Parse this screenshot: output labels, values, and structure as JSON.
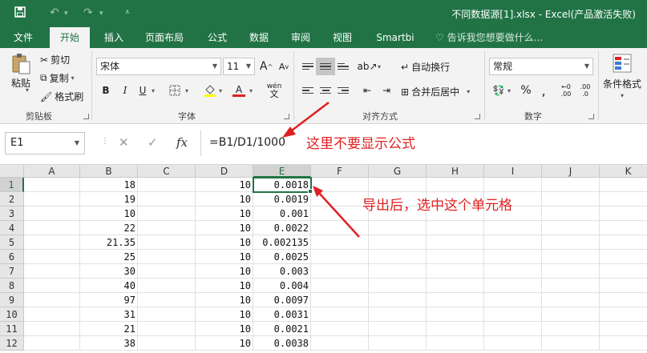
{
  "window": {
    "title": "不同数据源[1].xlsx - Excel(产品激活失败)",
    "qat_save_icon": "save-icon",
    "qat_undo_icon": "undo-icon",
    "qat_redo_icon": "redo-icon",
    "qat_customize_icon": "customize-qat-icon"
  },
  "tabs": [
    "文件",
    "开始",
    "插入",
    "页面布局",
    "公式",
    "数据",
    "审阅",
    "视图",
    "Smartbi"
  ],
  "active_tab": "开始",
  "tellme": "告诉我您想要做什么...",
  "ribbon": {
    "clipboard": {
      "paste": "粘贴",
      "cut": "剪切",
      "copy": "复制",
      "format_painter": "格式刷",
      "label": "剪贴板"
    },
    "font": {
      "name": "宋体",
      "size": "11",
      "bold": "B",
      "italic": "I",
      "underline": "U",
      "grow": "A",
      "shrink": "A",
      "phonetic": "wén",
      "font_color_letter": "A",
      "label": "字体"
    },
    "alignment": {
      "wrap": "自动换行",
      "merge": "合并后居中",
      "label": "对齐方式"
    },
    "number": {
      "format": "常规",
      "percent": "%",
      "comma": ",",
      "inc_decimal": ".00",
      "dec_decimal": ".0",
      "label": "数字"
    },
    "styles": {
      "conditional": "条件格式"
    }
  },
  "formula_bar": {
    "name_box": "E1",
    "cancel": "✕",
    "enter": "✓",
    "fx": "fx",
    "formula": "=B1/D1/1000"
  },
  "grid": {
    "columns": [
      "A",
      "B",
      "C",
      "D",
      "E",
      "F",
      "G",
      "H",
      "I",
      "J",
      "K"
    ],
    "selected_column": "E",
    "selected_row": 1,
    "rows": [
      {
        "n": 1,
        "B": "18",
        "D": "10",
        "E": "0.0018"
      },
      {
        "n": 2,
        "B": "19",
        "D": "10",
        "E": "0.0019"
      },
      {
        "n": 3,
        "B": "10",
        "D": "10",
        "E": "0.001"
      },
      {
        "n": 4,
        "B": "22",
        "D": "10",
        "E": "0.0022"
      },
      {
        "n": 5,
        "B": "21.35",
        "D": "10",
        "E": "0.002135"
      },
      {
        "n": 6,
        "B": "25",
        "D": "10",
        "E": "0.0025"
      },
      {
        "n": 7,
        "B": "30",
        "D": "10",
        "E": "0.003"
      },
      {
        "n": 8,
        "B": "40",
        "D": "10",
        "E": "0.004"
      },
      {
        "n": 9,
        "B": "97",
        "D": "10",
        "E": "0.0097"
      },
      {
        "n": 10,
        "B": "31",
        "D": "10",
        "E": "0.0031"
      },
      {
        "n": 11,
        "B": "21",
        "D": "10",
        "E": "0.0021"
      },
      {
        "n": 12,
        "B": "38",
        "D": "10",
        "E": "0.0038"
      }
    ]
  },
  "annotations": {
    "formula_note": "这里不要显示公式",
    "cell_note": "导出后，选中这个单元格",
    "color": "#e02020"
  },
  "colors": {
    "brand": "#217346",
    "ribbon_bg": "#f3f3f3"
  }
}
